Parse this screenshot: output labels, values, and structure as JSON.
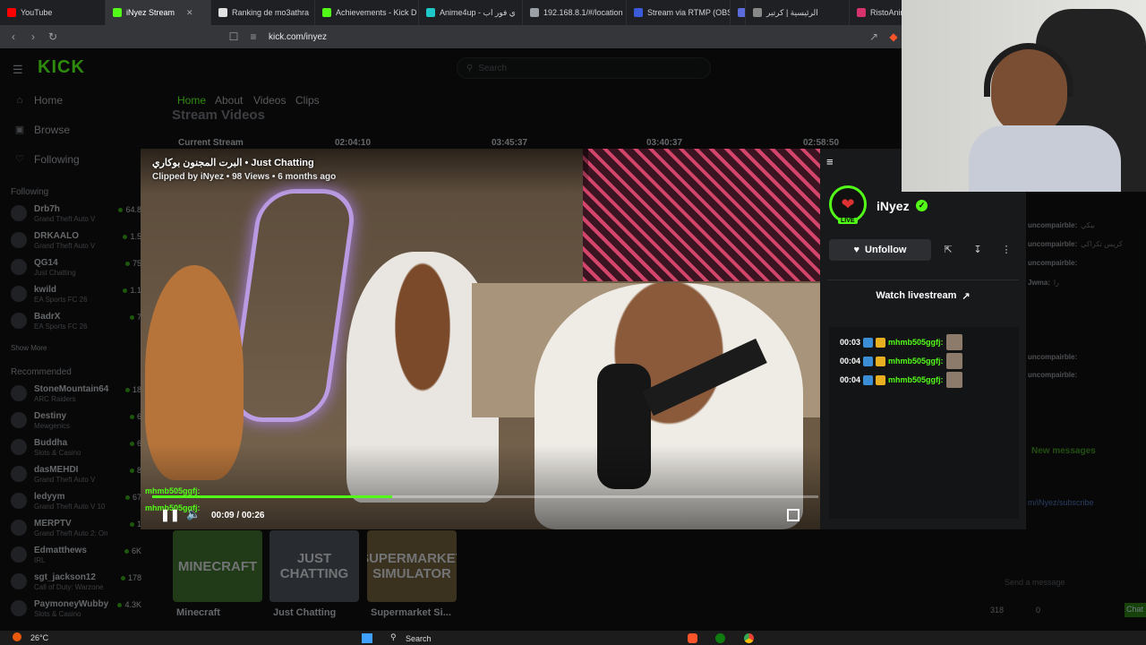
{
  "browser": {
    "tabs": [
      {
        "label": "YouTube",
        "color": "#ff0000",
        "active": false
      },
      {
        "label": "iNyez Stream",
        "color": "#53fc18",
        "active": true
      },
      {
        "label": "Ranking de mo3athra",
        "color": "#e0e0e0",
        "active": false
      },
      {
        "label": "Achievements - Kick D",
        "color": "#53fc18",
        "active": false
      },
      {
        "label": "Anime4up - ي فور اب",
        "color": "#1ec8c8",
        "active": false
      },
      {
        "label": "192.168.8.1/#/location",
        "color": "#9aa0a6",
        "active": false
      },
      {
        "label": "Stream via RTMP (OBS",
        "color": "#3b5bdb",
        "active": false
      },
      {
        "label": "",
        "color": "#5b6bdb",
        "active": false
      },
      {
        "label": "الرئيسية | كرتير",
        "color": "#888888",
        "active": false
      },
      {
        "label": "RistoAnime - ي",
        "color": "#d6336c",
        "active": false
      }
    ],
    "url": "kick.com/inyez"
  },
  "site": {
    "logo": "KICK",
    "search_placeholder": "Search",
    "nav": {
      "home": "Home",
      "browse": "Browse",
      "following": "Following"
    },
    "following_header": "Following",
    "following": [
      {
        "name": "Drb7h",
        "game": "Grand Theft Auto V",
        "viewers": "64.8"
      },
      {
        "name": "DRKAALO",
        "game": "Grand Theft Auto V",
        "viewers": "1.5"
      },
      {
        "name": "QG14",
        "game": "Just Chatting",
        "viewers": "75"
      },
      {
        "name": "kwild",
        "game": "EA Sports FC 26",
        "viewers": "1.1"
      },
      {
        "name": "BadrX",
        "game": "EA Sports FC 26",
        "viewers": "7"
      }
    ],
    "show_more": "Show More",
    "recommended_header": "Recommended",
    "recommended": [
      {
        "name": "StoneMountain64",
        "game": "ARC Raiders",
        "viewers": "18"
      },
      {
        "name": "Destiny",
        "game": "Mewgenics",
        "viewers": "6"
      },
      {
        "name": "Buddha",
        "game": "Slots & Casino",
        "viewers": "6"
      },
      {
        "name": "dasMEHDI",
        "game": "Grand Theft Auto V",
        "viewers": "8"
      },
      {
        "name": "ledyym",
        "game": "Grand Theft Auto V 10",
        "viewers": "67"
      },
      {
        "name": "MERPTV",
        "game": "Grand Theft Auto 2: On",
        "viewers": "1"
      },
      {
        "name": "Edmatthews",
        "game": "IRL",
        "viewers": "6K"
      },
      {
        "name": "sgt_jackson12",
        "game": "Call of Duty: Warzone",
        "viewers": "178"
      },
      {
        "name": "PaymoneyWubby",
        "game": "Slots & Casino",
        "viewers": "4.3K"
      }
    ],
    "channel_tabs": [
      "Home",
      "About",
      "Videos",
      "Clips"
    ],
    "section_title": "Stream Videos",
    "video_row": {
      "current": "Current Stream",
      "times": [
        "02:04:10",
        "03:45:37",
        "03:40:37",
        "02:58:50"
      ]
    },
    "categories": [
      {
        "title": "Minecraft",
        "art": "MINECRAFT",
        "color": "#3c6b2a"
      },
      {
        "title": "Just Chatting",
        "art": "JUST CHATTING",
        "color": "#4a4f58"
      },
      {
        "title": "Supermarket Si...",
        "art": "SUPERMARKET SIMULATOR",
        "color": "#6b5a3a"
      }
    ]
  },
  "clip": {
    "title": "البرت المجنون بوكاري • Just Chatting",
    "subtitle": "Clipped by iNyez • 98 Views • 6 months ago",
    "time": "00:09 / 00:26",
    "progress": 0.36,
    "overlay_names": [
      "mhmb505ggfj:",
      "mhmb505ggfj:"
    ]
  },
  "channel_panel": {
    "name": "iNyez",
    "live_badge": "LIVE",
    "unfollow": "Unfollow",
    "watch_livestream": "Watch livestream",
    "chat": [
      {
        "time": "00:03",
        "user": "mhmb505ggfj:"
      },
      {
        "time": "00:04",
        "user": "mhmb505ggfj:"
      },
      {
        "time": "00:04",
        "user": "mhmb505ggfj:"
      }
    ],
    "accent": "#53fc18"
  },
  "bg_chat": {
    "lines": [
      {
        "user": "uncompairble:",
        "text": "ﺑﻴﻜﻲ"
      },
      {
        "user": "uncompairble:",
        "text": "ﻛﺮﻳﺲ ﺗﻜﺮﺍﻛﻲ"
      },
      {
        "user": "uncompairble:",
        "text": ""
      },
      {
        "user": "Jwma:",
        "text": "ﺭﺍ"
      },
      {
        "user": "uncompairble:",
        "text": ""
      },
      {
        "user": "uncompairble:",
        "text": ""
      }
    ],
    "new_messages": "New messages",
    "link": "m/iNyez/subscribe",
    "send_placeholder": "Send a message",
    "stats": [
      "318",
      "0"
    ],
    "chat_button": "Chat"
  },
  "taskbar": {
    "temp": "26°C",
    "search": "Search"
  }
}
